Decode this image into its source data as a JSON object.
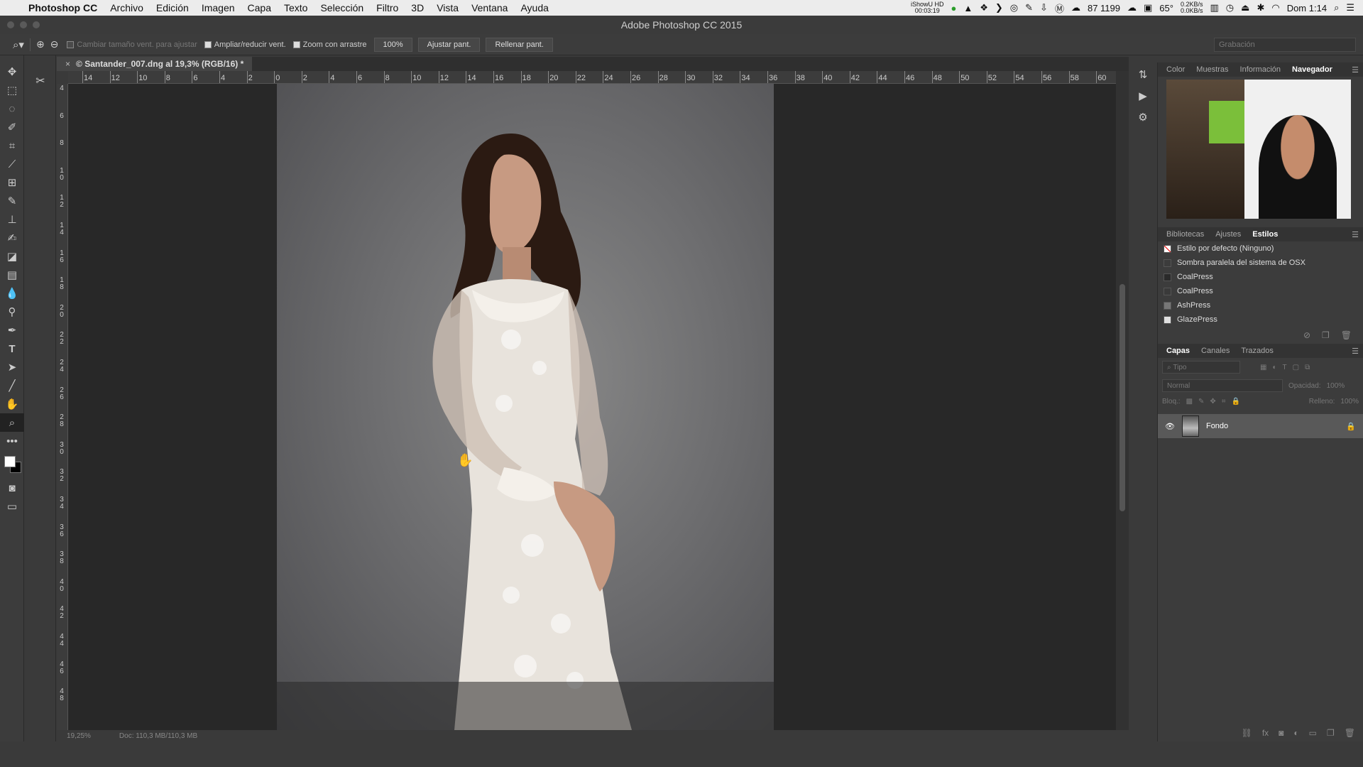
{
  "menubar": {
    "app_name": "Photoshop CC",
    "items": [
      "Archivo",
      "Edición",
      "Imagen",
      "Capa",
      "Texto",
      "Selección",
      "Filtro",
      "3D",
      "Vista",
      "Ventana",
      "Ayuda"
    ],
    "ishowu_label": "iShowU HD",
    "ishowu_time": "00:03:19",
    "counter": "87 1199",
    "temperature": "65°",
    "net_up": "0.2KB/s",
    "net_down": "0.0KB/s",
    "clock": "Dom 1:14"
  },
  "window": {
    "title": "Adobe Photoshop CC 2015"
  },
  "options": {
    "resize_windows_label": "Cambiar tamaño vent. para ajustar",
    "zoom_all_label": "Ampliar/reducir vent.",
    "scrubby_zoom_label": "Zoom con arrastre",
    "zoom_100_label": "100%",
    "fit_screen_label": "Ajustar pant.",
    "fill_screen_label": "Rellenar pant.",
    "workspace": "Grabación"
  },
  "document": {
    "tab_title": "© Santander_007.dng al 19,3% (RGB/16) *",
    "close_glyph": "×",
    "zoom": "19,25%",
    "doc_info": "Doc: 110,3 MB/110,3 MB"
  },
  "rulers": {
    "h_labels": [
      "14",
      "12",
      "10",
      "8",
      "6",
      "4",
      "2",
      "0",
      "2",
      "4",
      "6",
      "8",
      "10",
      "12",
      "14",
      "16",
      "18",
      "20",
      "22",
      "24",
      "26",
      "28",
      "30",
      "32",
      "34",
      "36",
      "38",
      "40",
      "42",
      "44",
      "46",
      "48",
      "50",
      "52",
      "54",
      "56",
      "58",
      "60"
    ],
    "v_labels": [
      "4",
      "6",
      "8",
      "10",
      "12",
      "14",
      "16",
      "18",
      "20",
      "22",
      "24",
      "26",
      "28",
      "30",
      "32",
      "34",
      "36",
      "38",
      "40",
      "42",
      "44",
      "46",
      "48"
    ]
  },
  "panels": {
    "nav_tabs": [
      "Color",
      "Muestras",
      "Información",
      "Navegador"
    ],
    "nav_active": "Navegador",
    "styles_tabs": [
      "Bibliotecas",
      "Ajustes",
      "Estilos"
    ],
    "styles_active": "Estilos",
    "styles": [
      {
        "name": "Estilo por defecto (Ninguno)",
        "color": "#ffffff"
      },
      {
        "name": "Sombra paralela del sistema de OSX",
        "color": "#3c3c3c"
      },
      {
        "name": "CoalPress",
        "color": "#2a2a2a"
      },
      {
        "name": "CoalPress",
        "color": "#3a3a3a"
      },
      {
        "name": "AshPress",
        "color": "#777777"
      },
      {
        "name": "GlazePress",
        "color": "#e0e0e0"
      }
    ],
    "layers_tabs": [
      "Capas",
      "Canales",
      "Trazados"
    ],
    "layers_active": "Capas",
    "filter_placeholder": "Tipo",
    "blend_mode": "Normal",
    "opacity_label": "Opacidad:",
    "opacity_value": "100%",
    "lock_label": "Bloq.:",
    "fill_label": "Relleno:",
    "fill_value": "100%",
    "layer_name": "Fondo"
  }
}
